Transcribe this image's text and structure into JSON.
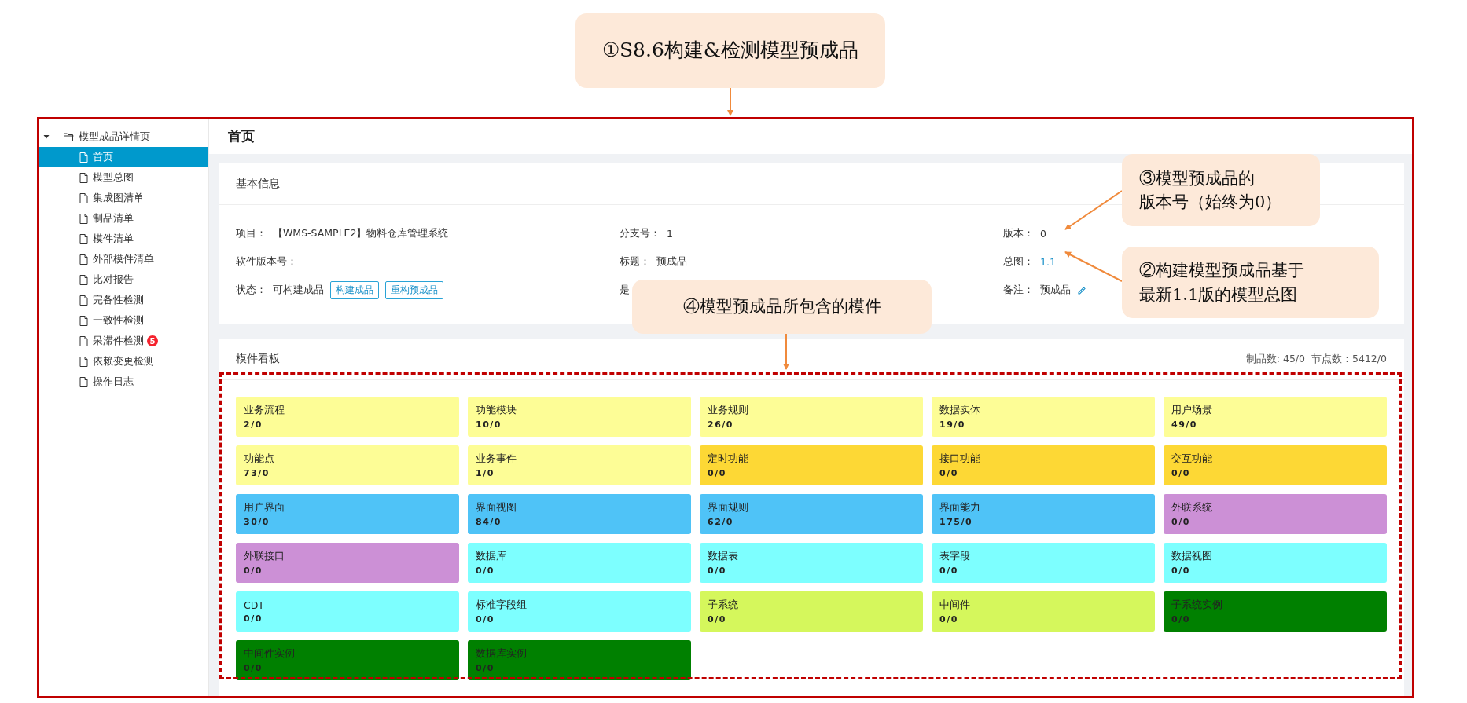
{
  "annotations": [
    {
      "lines": [
        "①S8.6构建&检测模型预成品"
      ]
    },
    {
      "lines": [
        "③模型预成品的",
        "版本号（始终为0）"
      ]
    },
    {
      "lines": [
        "②构建模型预成品基于",
        "最新1.1版的模型总图"
      ]
    },
    {
      "lines": [
        "④模型预成品所包含的模件"
      ]
    }
  ],
  "sidebar": {
    "root": {
      "label": "模型成品详情页",
      "expanded": true,
      "children": [
        {
          "label": "首页",
          "selected": true
        },
        {
          "label": "模型总图",
          "selected": false
        },
        {
          "label": "集成图清单",
          "selected": false
        },
        {
          "label": "制品清单",
          "selected": false
        },
        {
          "label": "模件清单",
          "selected": false
        },
        {
          "label": "外部模件清单",
          "selected": false
        },
        {
          "label": "比对报告",
          "selected": false
        },
        {
          "label": "完备性检测",
          "selected": false
        },
        {
          "label": "一致性检测",
          "selected": false
        },
        {
          "label": "呆滞件检测",
          "selected": false,
          "badge": "5"
        },
        {
          "label": "依赖变更检测",
          "selected": false
        },
        {
          "label": "操作日志",
          "selected": false
        }
      ]
    }
  },
  "page_title": "首页",
  "basic_info": {
    "title": "基本信息",
    "fields": [
      {
        "kind": "text",
        "label": "项目：",
        "value": "【WMS-SAMPLE2】物料仓库管理系统"
      },
      {
        "kind": "text",
        "label": "分支号：",
        "value": "1"
      },
      {
        "kind": "text",
        "label": "版本：",
        "value": "0"
      },
      {
        "kind": "text",
        "label": "软件版本号："
      },
      {
        "kind": "text",
        "label": "标题：",
        "value": "预成品"
      },
      {
        "kind": "link",
        "label": "总图：",
        "value": "1.1"
      },
      {
        "kind": "buttons",
        "label": "状态：",
        "value": "可构建成品",
        "buttons": [
          "构建成品",
          "重构预成品"
        ]
      },
      {
        "kind": "text",
        "label": "是"
      },
      {
        "kind": "edit",
        "label": "备注：",
        "value": "预成品"
      }
    ]
  },
  "board": {
    "title": "模件看板",
    "stats": [
      "制品数: 45/0",
      "节点数：5412/0"
    ],
    "tiles": [
      {
        "name": "业务流程",
        "count": "2/0",
        "color": "#fdfd96"
      },
      {
        "name": "功能模块",
        "count": "10/0",
        "color": "#fdfd96"
      },
      {
        "name": "业务规则",
        "count": "26/0",
        "color": "#fdfd96"
      },
      {
        "name": "数据实体",
        "count": "19/0",
        "color": "#fdfd96"
      },
      {
        "name": "用户场景",
        "count": "49/0",
        "color": "#fdfd96"
      },
      {
        "name": "功能点",
        "count": "73/0",
        "color": "#fdfd96"
      },
      {
        "name": "业务事件",
        "count": "1/0",
        "color": "#fdfd96"
      },
      {
        "name": "定时功能",
        "count": "0/0",
        "color": "#fdd835"
      },
      {
        "name": "接口功能",
        "count": "0/0",
        "color": "#fdd835"
      },
      {
        "name": "交互功能",
        "count": "0/0",
        "color": "#fdd835"
      },
      {
        "name": "用户界面",
        "count": "30/0",
        "color": "#4fc3f7"
      },
      {
        "name": "界面视图",
        "count": "84/0",
        "color": "#4fc3f7"
      },
      {
        "name": "界面规则",
        "count": "62/0",
        "color": "#4fc3f7"
      },
      {
        "name": "界面能力",
        "count": "175/0",
        "color": "#4fc3f7"
      },
      {
        "name": "外联系统",
        "count": "0/0",
        "color": "#cc90d6"
      },
      {
        "name": "外联接口",
        "count": "0/0",
        "color": "#cc90d6"
      },
      {
        "name": "数据库",
        "count": "0/0",
        "color": "#7dffff"
      },
      {
        "name": "数据表",
        "count": "0/0",
        "color": "#7dffff"
      },
      {
        "name": "表字段",
        "count": "0/0",
        "color": "#7dffff"
      },
      {
        "name": "数据视图",
        "count": "0/0",
        "color": "#7dffff"
      },
      {
        "name": "CDT",
        "count": "0/0",
        "color": "#7dffff"
      },
      {
        "name": "标准字段组",
        "count": "0/0",
        "color": "#7dffff"
      },
      {
        "name": "子系统",
        "count": "0/0",
        "color": "#d5f75c"
      },
      {
        "name": "中间件",
        "count": "0/0",
        "color": "#d5f75c"
      },
      {
        "name": "子系统实例",
        "count": "0/0",
        "color": "#008000"
      },
      {
        "name": "中间件实例",
        "count": "0/0",
        "color": "#008000"
      },
      {
        "name": "数据库实例",
        "count": "0/0",
        "color": "#008000"
      }
    ]
  }
}
